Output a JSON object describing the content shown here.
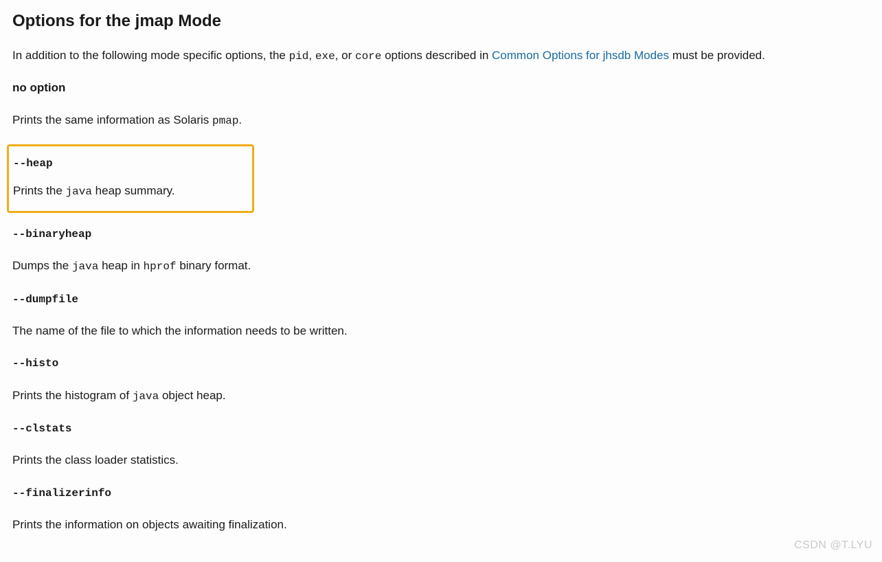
{
  "heading": "Options for the jmap Mode",
  "intro": {
    "pre": "In addition to the following mode specific options, the ",
    "code1": "pid",
    "sep1": ", ",
    "code2": "exe",
    "sep2": ", or ",
    "code3": "core",
    "mid": " options described in ",
    "link": "Common Options for jhsdb Modes",
    "post": " must be provided."
  },
  "no_option": {
    "term": "no option",
    "desc_pre": "Prints the same information as Solaris ",
    "desc_code": "pmap",
    "desc_post": "."
  },
  "heap": {
    "term": "--heap",
    "desc_pre": "Prints the ",
    "desc_code": "java",
    "desc_post": " heap summary."
  },
  "binaryheap": {
    "term": "--binaryheap",
    "desc_pre": "Dumps the ",
    "desc_code1": "java",
    "desc_mid": " heap in ",
    "desc_code2": "hprof",
    "desc_post": " binary format."
  },
  "dumpfile": {
    "term": "--dumpfile",
    "desc": "The name of the file to which the information needs to be written."
  },
  "histo": {
    "term": "--histo",
    "desc_pre": "Prints the histogram of ",
    "desc_code": "java",
    "desc_post": " object heap."
  },
  "clstats": {
    "term": "--clstats",
    "desc": "Prints the class loader statistics."
  },
  "finalizerinfo": {
    "term": "--finalizerinfo",
    "desc": "Prints the information on objects awaiting finalization."
  },
  "watermark": "CSDN @T.LYU"
}
